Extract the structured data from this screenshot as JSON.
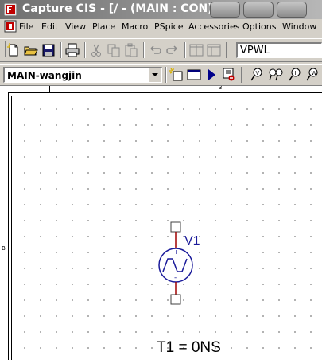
{
  "window": {
    "title": "Capture CIS - [/ - (MAIN : CON)]"
  },
  "menu": {
    "items": [
      {
        "label": "File"
      },
      {
        "label": "Edit"
      },
      {
        "label": "View"
      },
      {
        "label": "Place"
      },
      {
        "label": "Macro"
      },
      {
        "label": "PSpice"
      },
      {
        "label": "Accessories"
      },
      {
        "label": "Options"
      },
      {
        "label": "Window"
      }
    ]
  },
  "toolbar": {
    "part_combo_value": "VPWL",
    "project_combo_value": "MAIN-wangjin"
  },
  "ruler": {
    "top_label": "3",
    "left_label": "B"
  },
  "schematic": {
    "source_name": "V1",
    "source_plus": "+",
    "source_minus": "-",
    "property_text": "T1 = 0NS"
  },
  "colors": {
    "wire": "#a00000",
    "part": "#1a1a9a",
    "pin_box": "#404040",
    "accent": "#000080"
  }
}
